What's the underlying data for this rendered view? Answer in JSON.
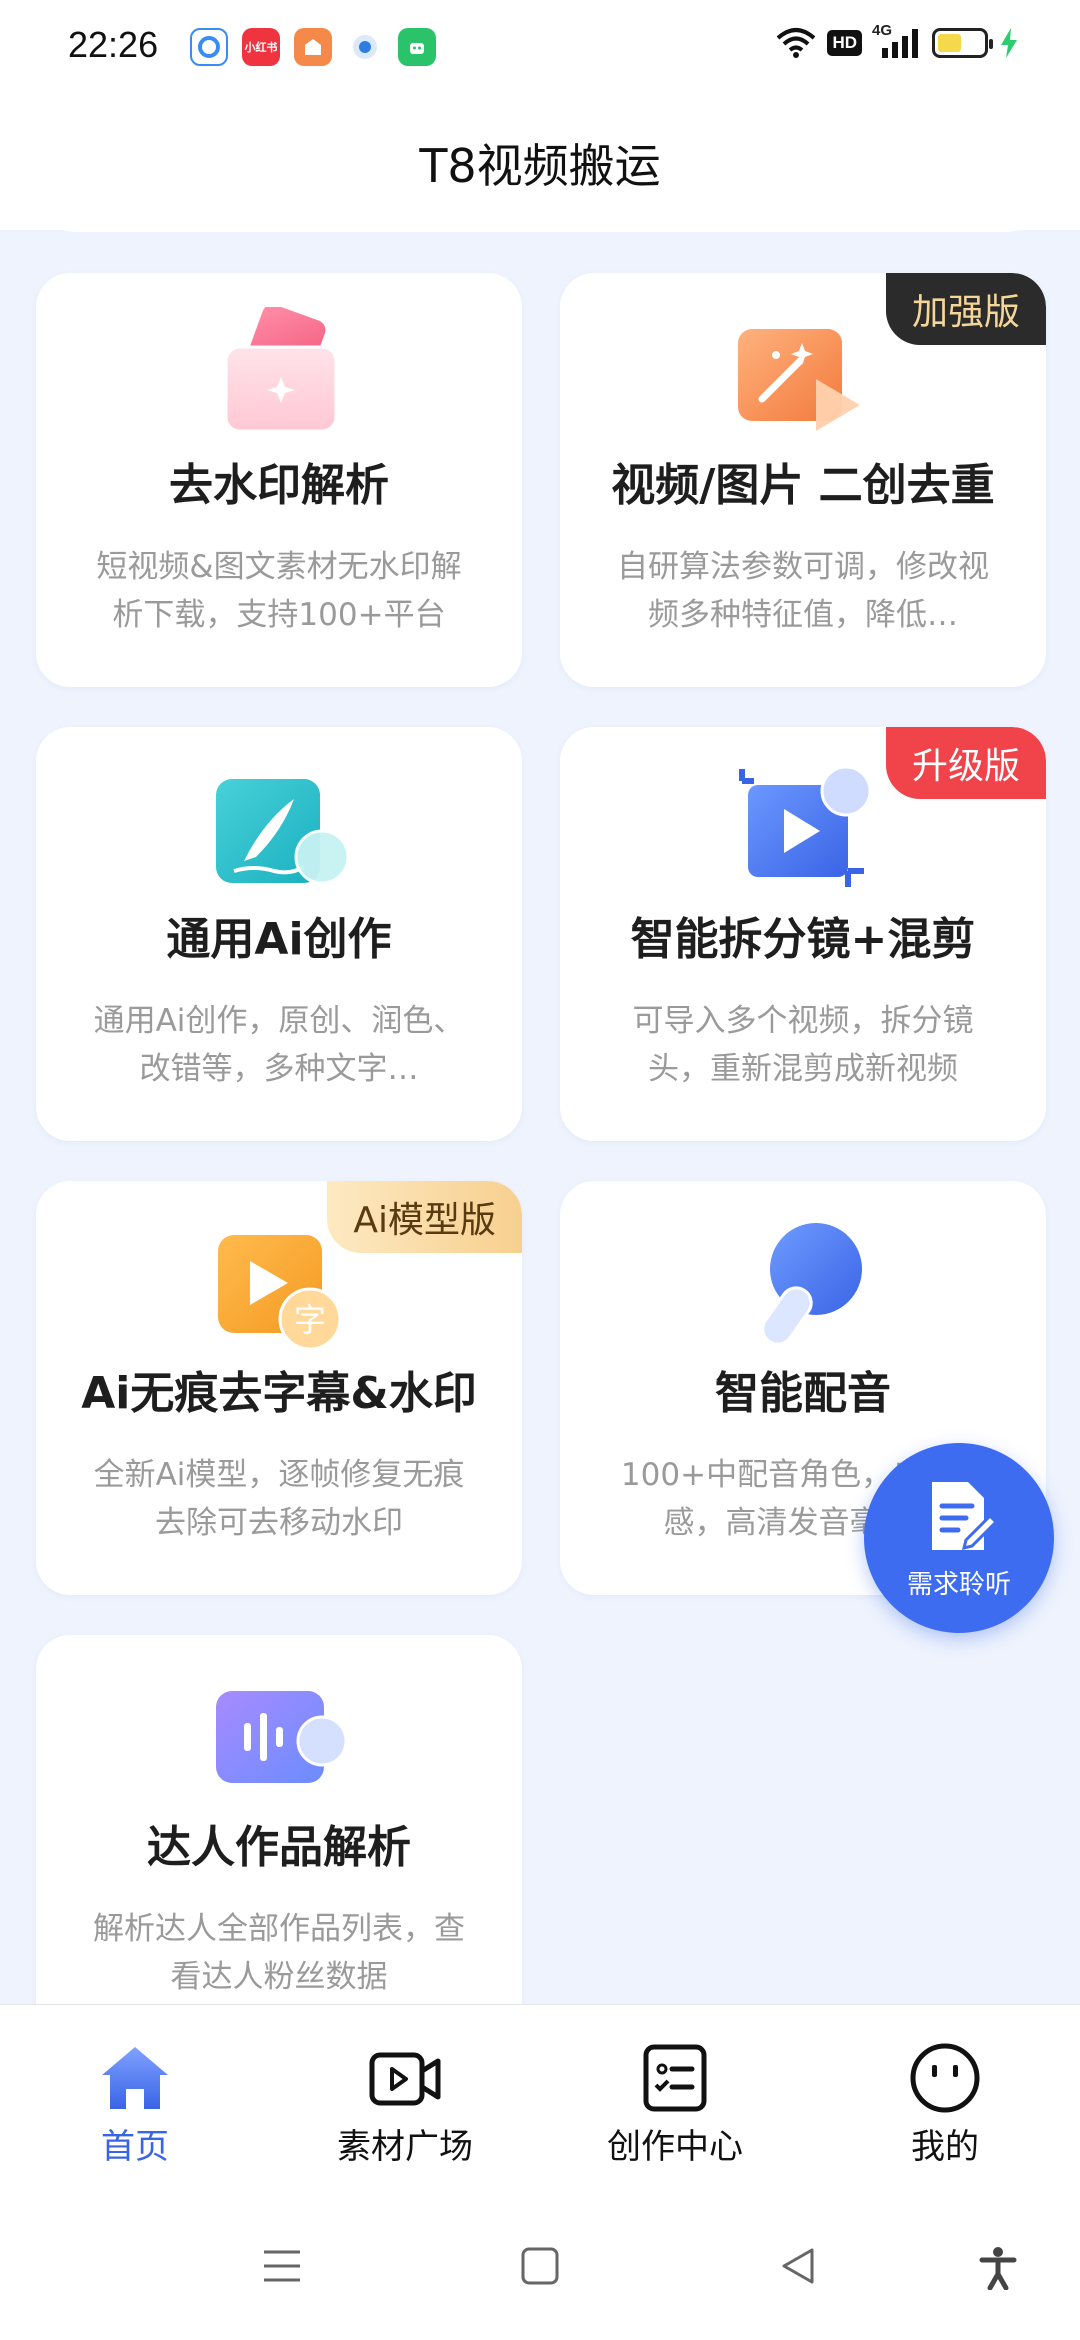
{
  "status_bar": {
    "time": "22:26",
    "hd": "HD",
    "network": "4G",
    "apps": [
      {
        "name": "browser-app-icon",
        "label": "",
        "color": "#3a8cf5"
      },
      {
        "name": "xiaohongshu-app-icon",
        "label": "小红书",
        "color": "#f0343f"
      },
      {
        "name": "shop-app-icon",
        "label": "",
        "color": "#f5894a"
      },
      {
        "name": "circle-app-icon",
        "label": "",
        "color": "#2f7de0"
      },
      {
        "name": "android-app-icon",
        "label": "",
        "color": "#2ac36a"
      }
    ]
  },
  "header": {
    "title": "T8视频搬运"
  },
  "cards": [
    {
      "title": "去水印解析",
      "desc": "短视频&图文素材无水印解析下载，支持100+平台",
      "badge": ""
    },
    {
      "title": "视频/图片 二创去重",
      "desc": "自研算法参数可调，修改视频多种特征值，降低…",
      "badge": "加强版"
    },
    {
      "title": "通用Ai创作",
      "desc": "通用Ai创作，原创、润色、改错等，多种文字…",
      "badge": ""
    },
    {
      "title": "智能拆分镜+混剪",
      "desc": "可导入多个视频，拆分镜头，重新混剪成新视频",
      "badge": "升级版"
    },
    {
      "title": "Ai无痕去字幕&水印",
      "desc": "全新Ai模型，逐帧修复无痕去除可去移动水印",
      "badge": "Ai模型版"
    },
    {
      "title": "智能配音",
      "desc": "100+中配音角色，自然情感，高清发音毫无…",
      "badge": ""
    },
    {
      "title": "达人作品解析",
      "desc": "解析达人全部作品列表，查看达人粉丝数据",
      "badge": ""
    }
  ],
  "fab": {
    "label": "需求聆听"
  },
  "bottom_nav": [
    {
      "label": "首页",
      "active": true
    },
    {
      "label": "素材广场",
      "active": false
    },
    {
      "label": "创作中心",
      "active": false
    },
    {
      "label": "我的",
      "active": false
    }
  ],
  "colors": {
    "accent": "#3a64e6",
    "badge_red": "#f0434a",
    "badge_dark": "#2b2b2b"
  }
}
